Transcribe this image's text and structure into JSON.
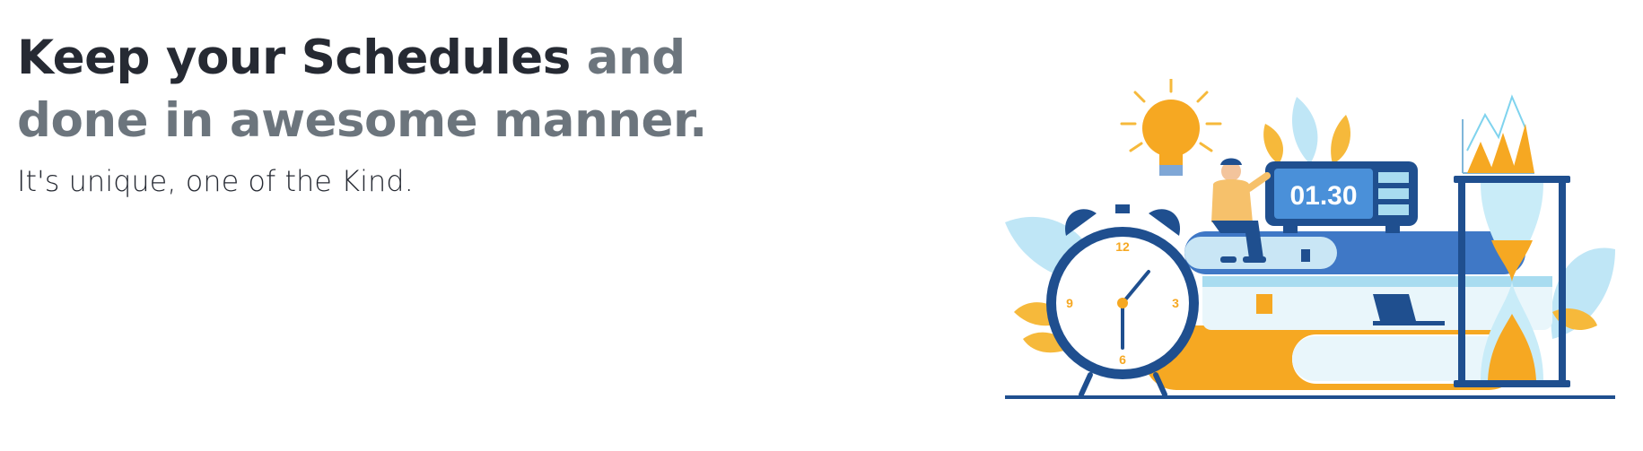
{
  "hero": {
    "headline_dark": "Keep your Schedules",
    "headline_muted": "and done in awesome manner.",
    "tagline": "It's unique, one of the Kind."
  },
  "illustration": {
    "display_time": "01.30",
    "clock_labels": {
      "twelve": "12",
      "three": "3",
      "six": "6",
      "nine": "9"
    },
    "colors": {
      "blue": "#1f4f8f",
      "orange": "#f6a822",
      "light_blue": "#a8dcf0"
    },
    "icons": [
      "light-bulb-icon",
      "alarm-clock-icon",
      "digital-clock-icon",
      "hourglass-icon",
      "books-icon",
      "person-icon",
      "laptop-icon",
      "chart-icon",
      "leaf-icon"
    ]
  }
}
